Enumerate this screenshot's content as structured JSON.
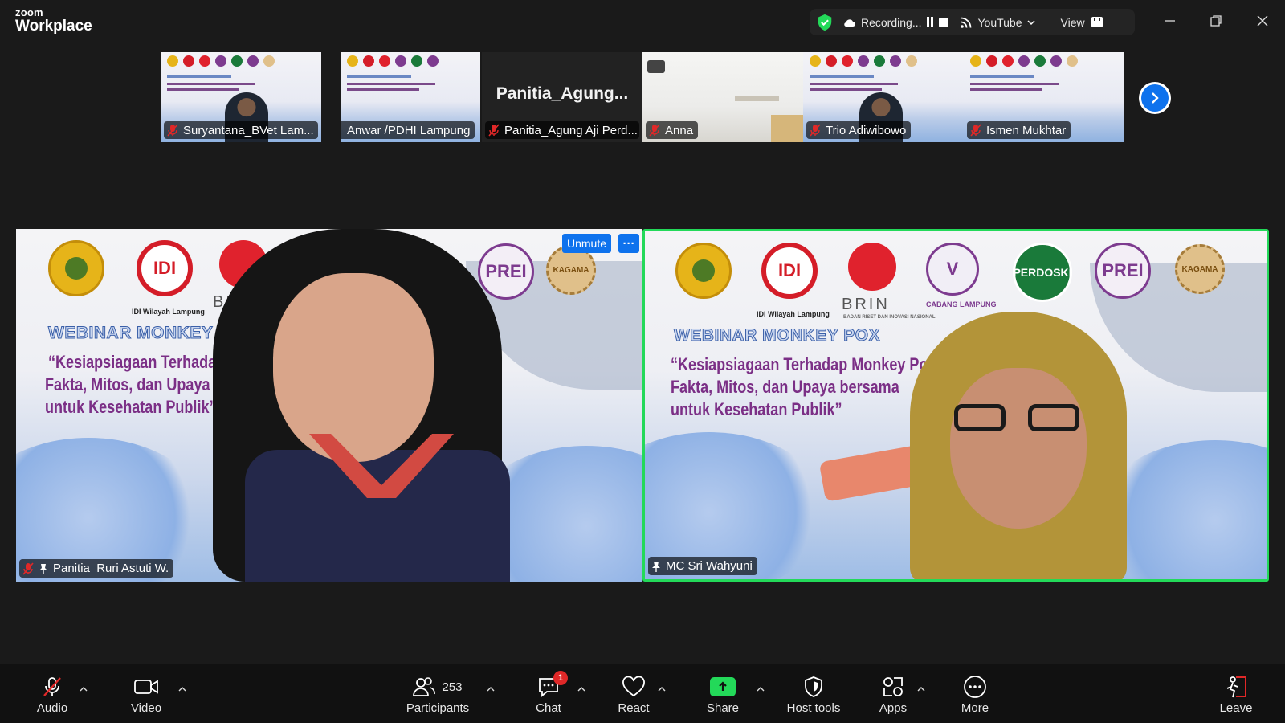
{
  "app": {
    "logo_line1": "zoom",
    "logo_line2": "Workplace"
  },
  "status_bar": {
    "recording_label": "Recording...",
    "stream_label": "YouTube",
    "view_label": "View"
  },
  "gallery": [
    {
      "name": "Suryantana_BVet Lam...",
      "type": "video"
    },
    {
      "name": "Anwar /PDHI Lampung",
      "type": "video"
    },
    {
      "name": "Panitia_Agung Aji Perd...",
      "big_name": "Panitia_Agung...",
      "type": "name"
    },
    {
      "name": "Anna",
      "type": "room"
    },
    {
      "name": "Trio Adiwibowo",
      "type": "video"
    },
    {
      "name": "Ismen Mukhtar",
      "type": "video"
    }
  ],
  "banner": {
    "title": "WEBINAR MONKEY POX",
    "quote_line1": "“Kesiapsiagaan Terhadap Monkey Pox",
    "quote_line2": "Fakta, Mitos, dan Upaya bersama",
    "quote_line3": "untuk Kesehatan Publik”",
    "quote_line1_left": "“Kesiapsiagaan Terhadap Monk",
    "quote_line2_left": "Fakta, Mitos, dan Upaya bersam",
    "idi_caption": "IDI Wilayah Lampung",
    "brin_word": "BRIN",
    "brin_caption": "BADAN RISET DAN INOVASI NASIONAL",
    "pdhi_caption": "CABANG LAMPUNG",
    "kagama_caption": "KAGAMA",
    "logo_idi": "IDI",
    "logo_pdhi": "V",
    "logo_perdoski": "PERDOSKI",
    "logo_prei": "PREI"
  },
  "main_tiles": [
    {
      "name": "Panitia_Ruri Astuti W.",
      "muted": true,
      "pinned": true
    },
    {
      "name": "MC Sri Wahyuni",
      "muted": false,
      "pinned": true,
      "active_speaker": true
    }
  ],
  "tile_actions": {
    "unmute_label": "Unmute",
    "more_label": "···"
  },
  "toolbar": {
    "audio": "Audio",
    "video": "Video",
    "participants": "Participants",
    "participants_count": "253",
    "chat": "Chat",
    "chat_badge": "1",
    "react": "React",
    "share": "Share",
    "host_tools": "Host tools",
    "apps": "Apps",
    "more": "More",
    "leave": "Leave"
  },
  "colors": {
    "accent_blue": "#0e72ed",
    "active_speaker_green": "#23d959",
    "share_green": "#23d959",
    "muted_red": "#e02828",
    "banner_purple": "#7b2f86"
  }
}
